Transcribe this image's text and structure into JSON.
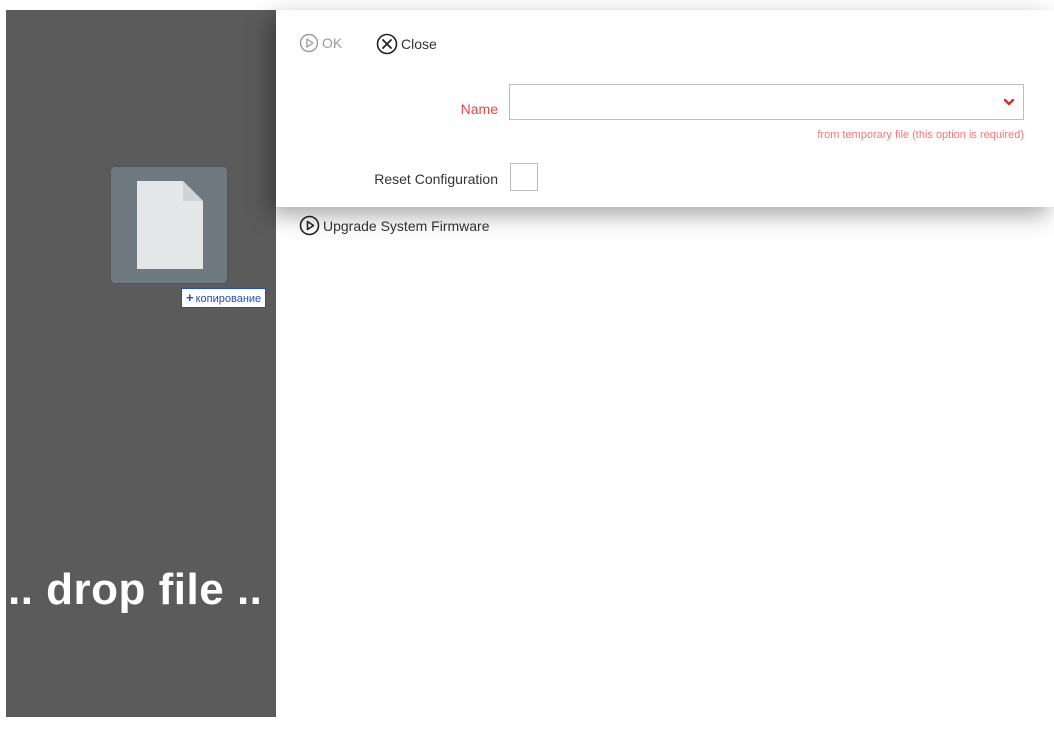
{
  "dropzone": {
    "text": ".. drop file ..",
    "copy_badge": "копирование",
    "copy_icon": "plus-icon"
  },
  "toolbar": {
    "ok_label": "OK",
    "ok_icon": "play-circle-icon",
    "close_label": "Close",
    "close_icon": "close-circle-icon"
  },
  "form": {
    "name_label": "Name",
    "name_value": "",
    "name_hint": "from temporary file (this option is required)",
    "reset_label": "Reset Configuration",
    "reset_checked": false
  },
  "actions": {
    "upgrade_label": "Upgrade System Firmware",
    "upgrade_icon": "play-circle-icon"
  },
  "colors": {
    "required": "#e24848",
    "dropzone_bg": "#5b5b5b",
    "badge_accent": "#1f4fbf"
  }
}
